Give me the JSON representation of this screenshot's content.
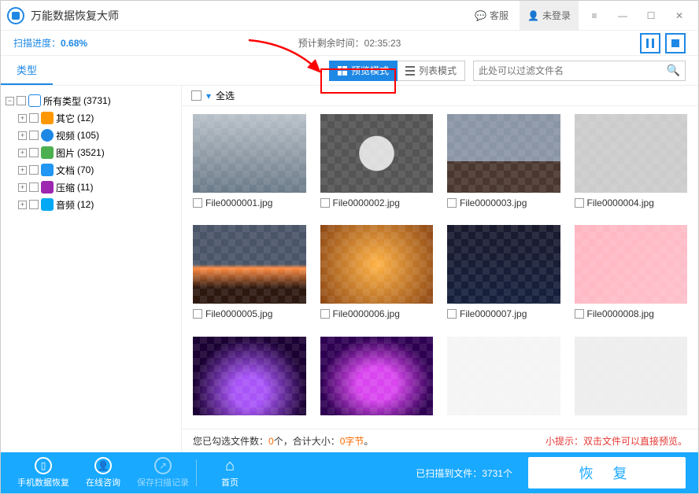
{
  "app_title": "万能数据恢复大师",
  "titlebar": {
    "service": "客服",
    "login": "未登录"
  },
  "progress": {
    "label": "扫描进度：",
    "percent": "0.68%",
    "eta_label": "预计剩余时间：",
    "eta_value": "02:35:23"
  },
  "tabs": {
    "type": "类型"
  },
  "modes": {
    "preview": "预览模式",
    "list": "列表模式"
  },
  "filter": {
    "placeholder": "此处可以过滤文件名"
  },
  "tree": {
    "root": {
      "label": "所有类型",
      "count": "(3731)"
    },
    "children": [
      {
        "key": "other",
        "label": "其它",
        "count": "(12)"
      },
      {
        "key": "video",
        "label": "视频",
        "count": "(105)"
      },
      {
        "key": "pic",
        "label": "图片",
        "count": "(3521)"
      },
      {
        "key": "doc",
        "label": "文档",
        "count": "(70)"
      },
      {
        "key": "zip",
        "label": "压缩",
        "count": "(11)"
      },
      {
        "key": "audio",
        "label": "音频",
        "count": "(12)"
      }
    ]
  },
  "select_all": "全选",
  "files": [
    {
      "name": "File0000001.jpg"
    },
    {
      "name": "File0000002.jpg"
    },
    {
      "name": "File0000003.jpg"
    },
    {
      "name": "File0000004.jpg"
    },
    {
      "name": "File0000005.jpg"
    },
    {
      "name": "File0000006.jpg"
    },
    {
      "name": "File0000007.jpg"
    },
    {
      "name": "File0000008.jpg"
    },
    {
      "name": ""
    },
    {
      "name": ""
    },
    {
      "name": ""
    },
    {
      "name": ""
    }
  ],
  "status": {
    "selected_prefix": "您已勾选文件数：",
    "selected_count": "0",
    "selected_mid": "个，合计大小：",
    "selected_size": "0字节",
    "selected_suffix": "。",
    "tip": "小提示：双击文件可以直接预览。"
  },
  "bottom": {
    "phone": "手机数据恢复",
    "consult": "在线咨询",
    "save_scan": "保存扫描记录",
    "home": "首页",
    "scanned_prefix": "已扫描到文件：",
    "scanned_count": "3731",
    "scanned_suffix": "个",
    "recover": "恢 复"
  }
}
